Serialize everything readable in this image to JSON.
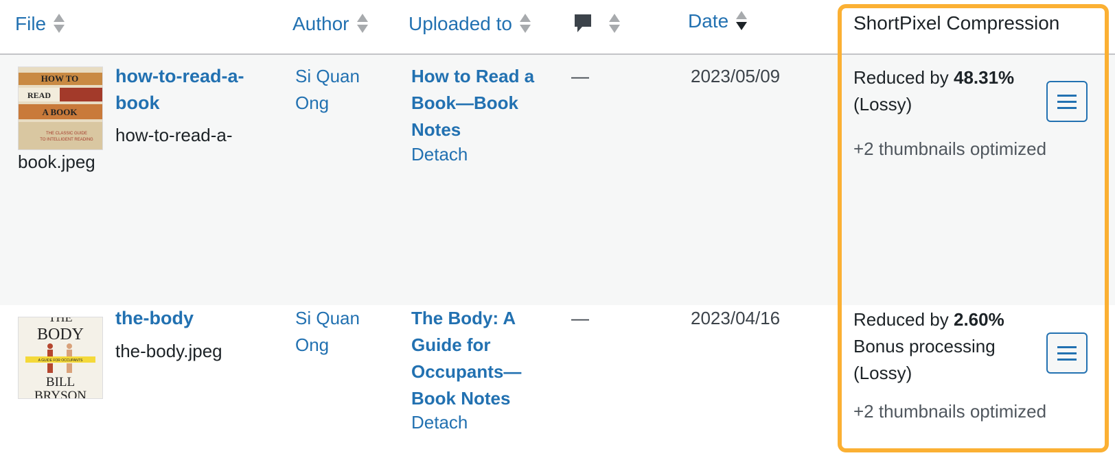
{
  "header": {
    "file": "File",
    "author": "Author",
    "uploaded_to": "Uploaded to",
    "comments_icon": "comment-bubble-icon",
    "date": "Date",
    "shortpixel": "ShortPixel Compression"
  },
  "rows": [
    {
      "title": "how-to-read-a-book",
      "title_line1": "how-to-read-a-",
      "title_line2": "book",
      "filename_line1": "how-to-read-a-",
      "filename_line2": "book.jpeg",
      "thumb": {
        "line1": "HOW TO",
        "line2": "READ",
        "line3": "A BOOK",
        "line4": "THE CLASSIC GUIDE",
        "line5": "TO INTELLIGENT READING"
      },
      "author_line1": "Si Quan",
      "author_line2": "Ong",
      "uploaded_line1": "How to Read a",
      "uploaded_line2": "Book—Book",
      "uploaded_line3": "Notes",
      "detach": "Detach",
      "comments": "—",
      "date": "2023/05/09",
      "sp_prefix": "Reduced by ",
      "sp_percent": "48.31%",
      "sp_line2": "(Lossy)",
      "sp_thumbs": "+2 thumbnails optimized"
    },
    {
      "title": "the-body",
      "filename": "the-body.jpeg",
      "thumb": {
        "line1": "THE",
        "line2": "BODY",
        "line3": "A GUIDE FOR OCCUPANTS",
        "line4": "BILL",
        "line5": "BRYSON"
      },
      "author_line1": "Si Quan",
      "author_line2": "Ong",
      "uploaded_line1": "The Body: A",
      "uploaded_line2": "Guide for",
      "uploaded_line3": "Occupants—",
      "uploaded_line4": "Book Notes",
      "detach": "Detach",
      "comments": "—",
      "date": "2023/04/16",
      "sp_prefix": "Reduced by ",
      "sp_percent": "2.60%",
      "sp_line2": "Bonus processing",
      "sp_line3": "(Lossy)",
      "sp_thumbs": "+2 thumbnails optimized"
    }
  ],
  "colors": {
    "link": "#2271b1",
    "highlight": "#fbb033",
    "row_alt": "#f6f7f7"
  }
}
